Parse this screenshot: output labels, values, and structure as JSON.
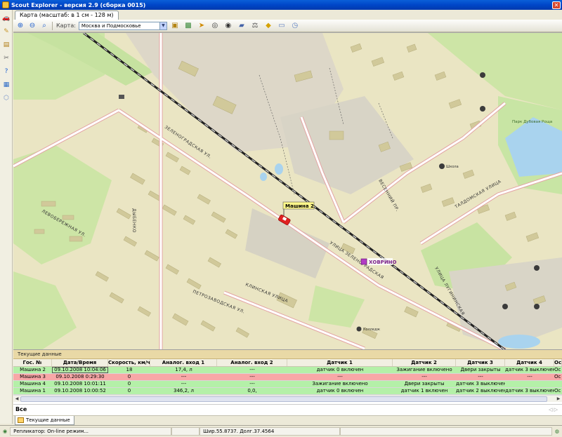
{
  "window": {
    "title": "Scout Explorer - версия 2.9 (сборка 0015)"
  },
  "tabs": [
    {
      "label": "Карта (масштаб: в 1 см - 128 м)"
    }
  ],
  "toolbar": {
    "map_label": "Карта:",
    "map_value": "Москва и Подмосковье"
  },
  "map": {
    "vehicle_label": "Машина 2",
    "station_label": "ХОВРИНО",
    "park_label": "Парк Дубовая Роща",
    "streets": [
      "ЗЕЛЕНОГРАДСКАЯ УЛ.",
      "УЛИЦА ЗЕЛЕНОГРАДСКАЯ",
      "ПЕТРОЗАВОДСКАЯ УЛ.",
      "КЛИНСКАЯ УЛИЦА",
      "УЛИЦА ЛУГИНИНСКАЯ",
      "ДЫБЕНКО",
      "ТАЛДОМСКАЯ УЛИЦА",
      "ЛЕВОБЕРЕЖНАЯ УЛ.",
      "ВЕСЕННИЙ ПР."
    ],
    "poi_labels": [
      "Школа",
      "Колледж"
    ]
  },
  "panel": {
    "title": "Текущие данные",
    "columns": [
      "Гос. №",
      "Дата/Время",
      "Скорость, км/ч",
      "Аналог. вход 1",
      "Аналог. вход 2",
      "Датчик 1",
      "Датчик 2",
      "Датчик 3",
      "Датчик 4",
      "Ос"
    ],
    "rows": [
      [
        "Машина 2",
        "09.10.2008 10:04:06",
        "18",
        "17,4, л",
        "---",
        "датчик 0 включен",
        "Зажигание включено",
        "Двери закрыты",
        "датчик 3 выключен",
        "Ос"
      ],
      [
        "Машина 3",
        "09.10.2008 0:29:30",
        "0",
        "---",
        "---",
        "---",
        "---",
        "---",
        "---",
        "Ос"
      ],
      [
        "Машина 4",
        "09.10.2008 10:01:11",
        "0",
        "---",
        "---",
        "Зажигание включено",
        "Двери закрыты",
        "датчик 3 выключен",
        "",
        ""
      ],
      [
        "Машина 1",
        "09.10.2008 10:00:52",
        "0",
        "346,2, л",
        "0,0,",
        "датчик 0 включен",
        "датчик 1 включен",
        "датчик 2 выключен",
        "датчик 3 выключен",
        "Ос"
      ]
    ],
    "filter_label": "Все"
  },
  "bottom_tab": {
    "label": "Текущие данные"
  },
  "status": {
    "replicator": "Репликатор: On-line режим...",
    "coords": "Шир.55.8737. Долг.37.4564"
  }
}
